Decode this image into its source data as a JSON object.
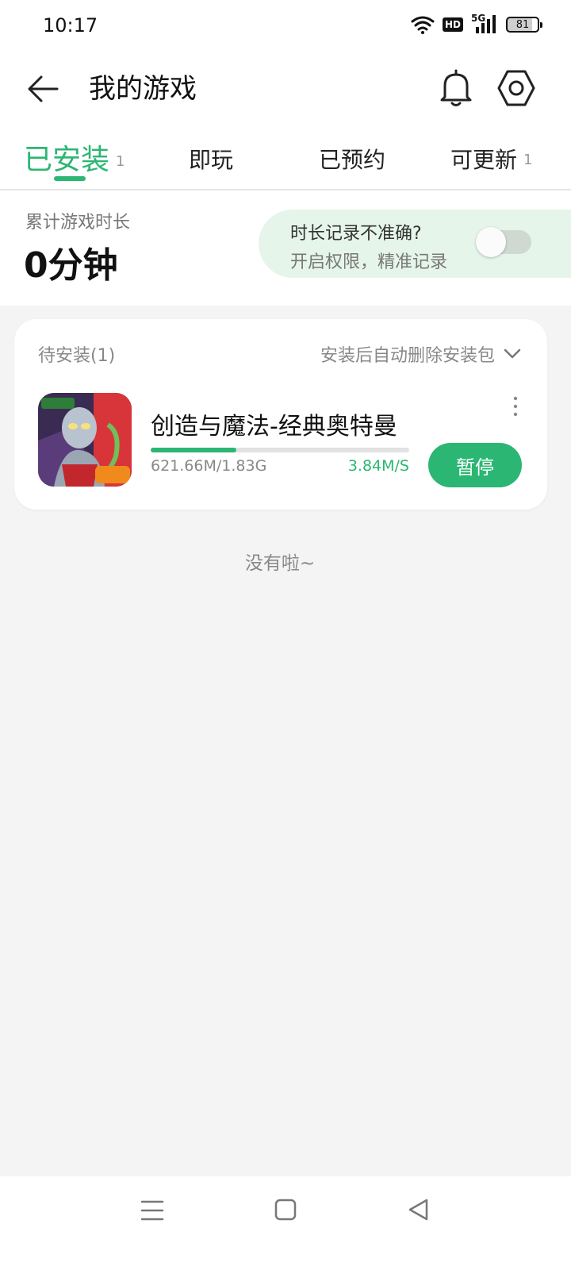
{
  "status_bar": {
    "time": "10:17",
    "network_label": "5G",
    "hd_label": "HD",
    "battery": "81"
  },
  "header": {
    "title": "我的游戏",
    "icons": [
      "back-arrow-icon",
      "bell-icon",
      "settings-icon"
    ]
  },
  "tabs": [
    {
      "label": "已安装",
      "count": "1",
      "active": true
    },
    {
      "label": "即玩",
      "count": "",
      "active": false
    },
    {
      "label": "已预约",
      "count": "",
      "active": false
    },
    {
      "label": "可更新",
      "count": "1",
      "active": false
    }
  ],
  "playtime": {
    "label": "累计游戏时长",
    "value": "0分钟"
  },
  "permission_prompt": {
    "title": "时长记录不准确?",
    "subtitle": "开启权限，精准记录",
    "toggle_on": false
  },
  "download_card": {
    "pending_label": "待安装(1)",
    "auto_delete_label": "安装后自动删除安装包",
    "app": {
      "name": "创造与魔法-经典奥特曼",
      "icon_badge": "4399",
      "size_progress": "621.66M/1.83G",
      "speed": "3.84M/S",
      "progress_fraction": 0.332,
      "action_label": "暂停"
    }
  },
  "end_note": "没有啦~",
  "colors": {
    "accent": "#2bb673",
    "background": "#f4f4f4",
    "prompt_bg": "#e6f5ea"
  },
  "nav_bar": {
    "icons": [
      "menu-icon",
      "home-icon",
      "back-triangle-icon"
    ]
  }
}
